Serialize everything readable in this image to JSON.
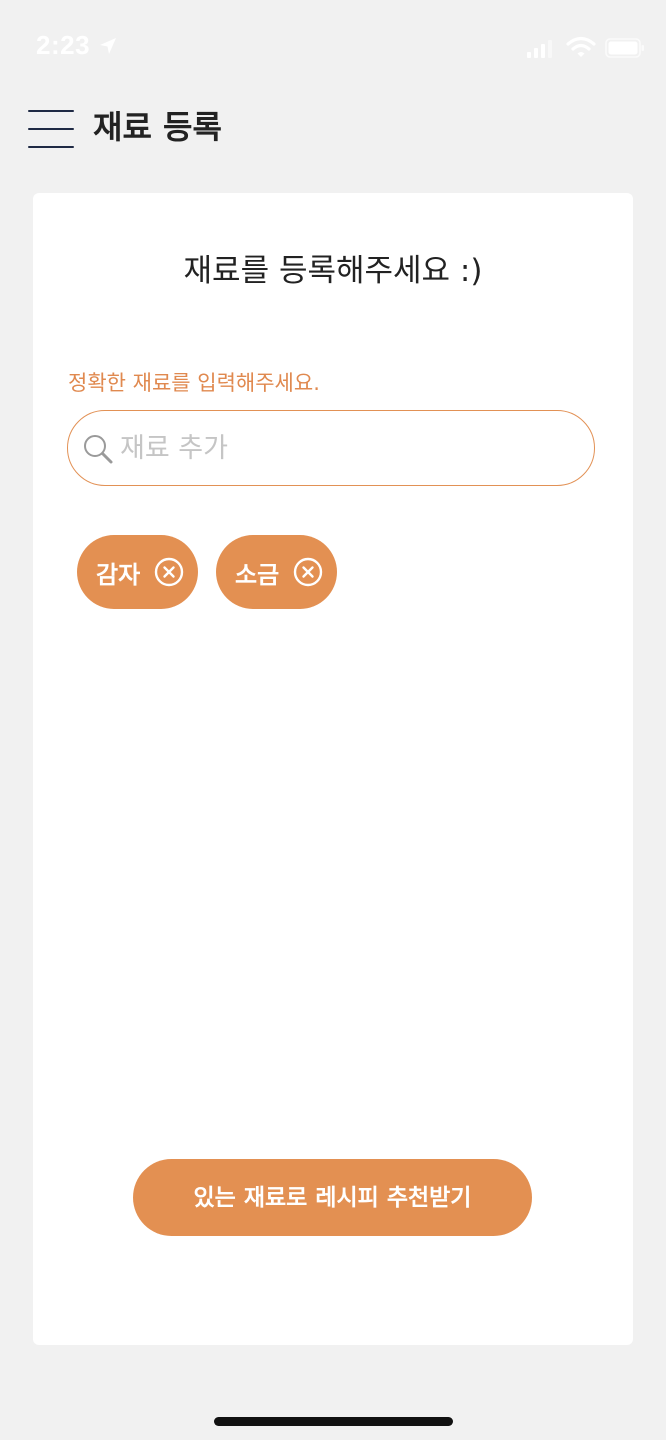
{
  "status_bar": {
    "time": "2:23",
    "icons": [
      "location-arrow-icon",
      "signal-icon",
      "wifi-icon",
      "battery-icon"
    ]
  },
  "header": {
    "menu_icon": "hamburger-menu-icon",
    "title": "재료 등록"
  },
  "main": {
    "title": "재료를 등록해주세요 :)",
    "hint": "정확한 재료를 입력해주세요.",
    "search": {
      "icon": "search-icon",
      "placeholder": "재료 추가",
      "value": ""
    },
    "ingredients": [
      {
        "label": "감자",
        "remove_icon": "close-circle-icon"
      },
      {
        "label": "소금",
        "remove_icon": "close-circle-icon"
      }
    ],
    "recommend_button_label": "있는 재료로 레시피 추천받기"
  },
  "colors": {
    "accent": "#e39052",
    "hint_text": "#e0894f",
    "background": "#f1f1f1",
    "card": "#ffffff",
    "title_text": "#222222",
    "menu_icon": "#1f2a44"
  }
}
